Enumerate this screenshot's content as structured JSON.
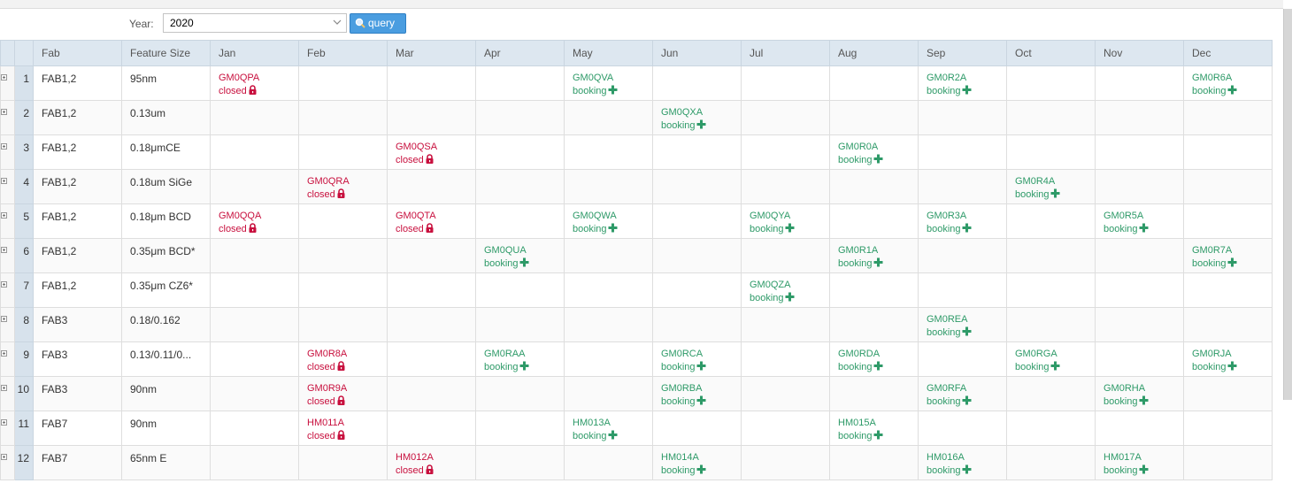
{
  "filter": {
    "year_label": "Year:",
    "year_value": "2020",
    "query_label": "query"
  },
  "colors": {
    "closed": "#c8103e",
    "booking": "#2e9a68",
    "header_bg": "#dde7f0",
    "button": "#4a9de0"
  },
  "icons": {
    "closed": "lock-icon",
    "booking": "plus-icon",
    "query": "search-icon",
    "expand": "expand-icon"
  },
  "table": {
    "headers": [
      "Fab",
      "Feature Size",
      "Jan",
      "Feb",
      "Mar",
      "Apr",
      "May",
      "Jun",
      "Jul",
      "Aug",
      "Sep",
      "Oct",
      "Nov",
      "Dec"
    ],
    "rows": [
      {
        "num": "1",
        "fab": "FAB1,2",
        "feature": "95nm",
        "months": [
          {
            "code": "GM0QPA",
            "status": "closed"
          },
          null,
          null,
          null,
          {
            "code": "GM0QVA",
            "status": "booking"
          },
          null,
          null,
          null,
          {
            "code": "GM0R2A",
            "status": "booking"
          },
          null,
          null,
          {
            "code": "GM0R6A",
            "status": "booking"
          }
        ]
      },
      {
        "num": "2",
        "fab": "FAB1,2",
        "feature": "0.13um",
        "months": [
          null,
          null,
          null,
          null,
          null,
          {
            "code": "GM0QXA",
            "status": "booking"
          },
          null,
          null,
          null,
          null,
          null,
          null
        ]
      },
      {
        "num": "3",
        "fab": "FAB1,2",
        "feature": "0.18μmCE",
        "months": [
          null,
          null,
          {
            "code": "GM0QSA",
            "status": "closed"
          },
          null,
          null,
          null,
          null,
          {
            "code": "GM0R0A",
            "status": "booking"
          },
          null,
          null,
          null,
          null
        ]
      },
      {
        "num": "4",
        "fab": "FAB1,2",
        "feature": "0.18um SiGe",
        "months": [
          null,
          {
            "code": "GM0QRA",
            "status": "closed"
          },
          null,
          null,
          null,
          null,
          null,
          null,
          null,
          {
            "code": "GM0R4A",
            "status": "booking"
          },
          null,
          null
        ]
      },
      {
        "num": "5",
        "fab": "FAB1,2",
        "feature": "0.18μm BCD",
        "months": [
          {
            "code": "GM0QQA",
            "status": "closed"
          },
          null,
          {
            "code": "GM0QTA",
            "status": "closed"
          },
          null,
          {
            "code": "GM0QWA",
            "status": "booking"
          },
          null,
          {
            "code": "GM0QYA",
            "status": "booking"
          },
          null,
          {
            "code": "GM0R3A",
            "status": "booking"
          },
          null,
          {
            "code": "GM0R5A",
            "status": "booking"
          },
          null
        ]
      },
      {
        "num": "6",
        "fab": "FAB1,2",
        "feature": "0.35μm BCD*",
        "months": [
          null,
          null,
          null,
          {
            "code": "GM0QUA",
            "status": "booking"
          },
          null,
          null,
          null,
          {
            "code": "GM0R1A",
            "status": "booking"
          },
          null,
          null,
          null,
          {
            "code": "GM0R7A",
            "status": "booking"
          }
        ]
      },
      {
        "num": "7",
        "fab": "FAB1,2",
        "feature": "0.35μm CZ6*",
        "months": [
          null,
          null,
          null,
          null,
          null,
          null,
          {
            "code": "GM0QZA",
            "status": "booking"
          },
          null,
          null,
          null,
          null,
          null
        ]
      },
      {
        "num": "8",
        "fab": "FAB3",
        "feature": "0.18/0.162",
        "months": [
          null,
          null,
          null,
          null,
          null,
          null,
          null,
          null,
          {
            "code": "GM0REA",
            "status": "booking"
          },
          null,
          null,
          null
        ]
      },
      {
        "num": "9",
        "fab": "FAB3",
        "feature": "0.13/0.11/0...",
        "months": [
          null,
          {
            "code": "GM0R8A",
            "status": "closed"
          },
          null,
          {
            "code": "GM0RAA",
            "status": "booking"
          },
          null,
          {
            "code": "GM0RCA",
            "status": "booking"
          },
          null,
          {
            "code": "GM0RDA",
            "status": "booking"
          },
          null,
          {
            "code": "GM0RGA",
            "status": "booking"
          },
          null,
          {
            "code": "GM0RJA",
            "status": "booking"
          }
        ]
      },
      {
        "num": "10",
        "fab": "FAB3",
        "feature": "90nm",
        "months": [
          null,
          {
            "code": "GM0R9A",
            "status": "closed"
          },
          null,
          null,
          null,
          {
            "code": "GM0RBA",
            "status": "booking"
          },
          null,
          null,
          {
            "code": "GM0RFA",
            "status": "booking"
          },
          null,
          {
            "code": "GM0RHA",
            "status": "booking"
          },
          null
        ]
      },
      {
        "num": "11",
        "fab": "FAB7",
        "feature": "90nm",
        "months": [
          null,
          {
            "code": "HM011A",
            "status": "closed"
          },
          null,
          null,
          {
            "code": "HM013A",
            "status": "booking"
          },
          null,
          null,
          {
            "code": "HM015A",
            "status": "booking"
          },
          null,
          null,
          null,
          null
        ]
      },
      {
        "num": "12",
        "fab": "FAB7",
        "feature": "65nm E",
        "months": [
          null,
          null,
          {
            "code": "HM012A",
            "status": "closed"
          },
          null,
          null,
          {
            "code": "HM014A",
            "status": "booking"
          },
          null,
          null,
          {
            "code": "HM016A",
            "status": "booking"
          },
          null,
          {
            "code": "HM017A",
            "status": "booking"
          },
          null
        ]
      }
    ]
  }
}
